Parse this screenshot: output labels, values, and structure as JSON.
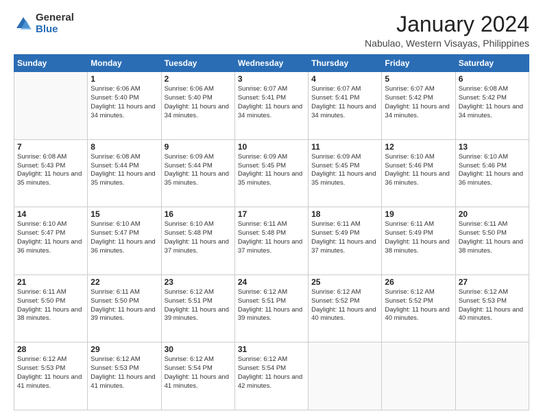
{
  "logo": {
    "general": "General",
    "blue": "Blue"
  },
  "title": "January 2024",
  "location": "Nabulao, Western Visayas, Philippines",
  "days_header": [
    "Sunday",
    "Monday",
    "Tuesday",
    "Wednesday",
    "Thursday",
    "Friday",
    "Saturday"
  ],
  "weeks": [
    [
      {
        "day": "",
        "sunrise": "",
        "sunset": "",
        "daylight": ""
      },
      {
        "day": "1",
        "sunrise": "Sunrise: 6:06 AM",
        "sunset": "Sunset: 5:40 PM",
        "daylight": "Daylight: 11 hours and 34 minutes."
      },
      {
        "day": "2",
        "sunrise": "Sunrise: 6:06 AM",
        "sunset": "Sunset: 5:40 PM",
        "daylight": "Daylight: 11 hours and 34 minutes."
      },
      {
        "day": "3",
        "sunrise": "Sunrise: 6:07 AM",
        "sunset": "Sunset: 5:41 PM",
        "daylight": "Daylight: 11 hours and 34 minutes."
      },
      {
        "day": "4",
        "sunrise": "Sunrise: 6:07 AM",
        "sunset": "Sunset: 5:41 PM",
        "daylight": "Daylight: 11 hours and 34 minutes."
      },
      {
        "day": "5",
        "sunrise": "Sunrise: 6:07 AM",
        "sunset": "Sunset: 5:42 PM",
        "daylight": "Daylight: 11 hours and 34 minutes."
      },
      {
        "day": "6",
        "sunrise": "Sunrise: 6:08 AM",
        "sunset": "Sunset: 5:42 PM",
        "daylight": "Daylight: 11 hours and 34 minutes."
      }
    ],
    [
      {
        "day": "7",
        "sunrise": "Sunrise: 6:08 AM",
        "sunset": "Sunset: 5:43 PM",
        "daylight": "Daylight: 11 hours and 35 minutes."
      },
      {
        "day": "8",
        "sunrise": "Sunrise: 6:08 AM",
        "sunset": "Sunset: 5:44 PM",
        "daylight": "Daylight: 11 hours and 35 minutes."
      },
      {
        "day": "9",
        "sunrise": "Sunrise: 6:09 AM",
        "sunset": "Sunset: 5:44 PM",
        "daylight": "Daylight: 11 hours and 35 minutes."
      },
      {
        "day": "10",
        "sunrise": "Sunrise: 6:09 AM",
        "sunset": "Sunset: 5:45 PM",
        "daylight": "Daylight: 11 hours and 35 minutes."
      },
      {
        "day": "11",
        "sunrise": "Sunrise: 6:09 AM",
        "sunset": "Sunset: 5:45 PM",
        "daylight": "Daylight: 11 hours and 35 minutes."
      },
      {
        "day": "12",
        "sunrise": "Sunrise: 6:10 AM",
        "sunset": "Sunset: 5:46 PM",
        "daylight": "Daylight: 11 hours and 36 minutes."
      },
      {
        "day": "13",
        "sunrise": "Sunrise: 6:10 AM",
        "sunset": "Sunset: 5:46 PM",
        "daylight": "Daylight: 11 hours and 36 minutes."
      }
    ],
    [
      {
        "day": "14",
        "sunrise": "Sunrise: 6:10 AM",
        "sunset": "Sunset: 5:47 PM",
        "daylight": "Daylight: 11 hours and 36 minutes."
      },
      {
        "day": "15",
        "sunrise": "Sunrise: 6:10 AM",
        "sunset": "Sunset: 5:47 PM",
        "daylight": "Daylight: 11 hours and 36 minutes."
      },
      {
        "day": "16",
        "sunrise": "Sunrise: 6:10 AM",
        "sunset": "Sunset: 5:48 PM",
        "daylight": "Daylight: 11 hours and 37 minutes."
      },
      {
        "day": "17",
        "sunrise": "Sunrise: 6:11 AM",
        "sunset": "Sunset: 5:48 PM",
        "daylight": "Daylight: 11 hours and 37 minutes."
      },
      {
        "day": "18",
        "sunrise": "Sunrise: 6:11 AM",
        "sunset": "Sunset: 5:49 PM",
        "daylight": "Daylight: 11 hours and 37 minutes."
      },
      {
        "day": "19",
        "sunrise": "Sunrise: 6:11 AM",
        "sunset": "Sunset: 5:49 PM",
        "daylight": "Daylight: 11 hours and 38 minutes."
      },
      {
        "day": "20",
        "sunrise": "Sunrise: 6:11 AM",
        "sunset": "Sunset: 5:50 PM",
        "daylight": "Daylight: 11 hours and 38 minutes."
      }
    ],
    [
      {
        "day": "21",
        "sunrise": "Sunrise: 6:11 AM",
        "sunset": "Sunset: 5:50 PM",
        "daylight": "Daylight: 11 hours and 38 minutes."
      },
      {
        "day": "22",
        "sunrise": "Sunrise: 6:11 AM",
        "sunset": "Sunset: 5:50 PM",
        "daylight": "Daylight: 11 hours and 39 minutes."
      },
      {
        "day": "23",
        "sunrise": "Sunrise: 6:12 AM",
        "sunset": "Sunset: 5:51 PM",
        "daylight": "Daylight: 11 hours and 39 minutes."
      },
      {
        "day": "24",
        "sunrise": "Sunrise: 6:12 AM",
        "sunset": "Sunset: 5:51 PM",
        "daylight": "Daylight: 11 hours and 39 minutes."
      },
      {
        "day": "25",
        "sunrise": "Sunrise: 6:12 AM",
        "sunset": "Sunset: 5:52 PM",
        "daylight": "Daylight: 11 hours and 40 minutes."
      },
      {
        "day": "26",
        "sunrise": "Sunrise: 6:12 AM",
        "sunset": "Sunset: 5:52 PM",
        "daylight": "Daylight: 11 hours and 40 minutes."
      },
      {
        "day": "27",
        "sunrise": "Sunrise: 6:12 AM",
        "sunset": "Sunset: 5:53 PM",
        "daylight": "Daylight: 11 hours and 40 minutes."
      }
    ],
    [
      {
        "day": "28",
        "sunrise": "Sunrise: 6:12 AM",
        "sunset": "Sunset: 5:53 PM",
        "daylight": "Daylight: 11 hours and 41 minutes."
      },
      {
        "day": "29",
        "sunrise": "Sunrise: 6:12 AM",
        "sunset": "Sunset: 5:53 PM",
        "daylight": "Daylight: 11 hours and 41 minutes."
      },
      {
        "day": "30",
        "sunrise": "Sunrise: 6:12 AM",
        "sunset": "Sunset: 5:54 PM",
        "daylight": "Daylight: 11 hours and 41 minutes."
      },
      {
        "day": "31",
        "sunrise": "Sunrise: 6:12 AM",
        "sunset": "Sunset: 5:54 PM",
        "daylight": "Daylight: 11 hours and 42 minutes."
      },
      {
        "day": "",
        "sunrise": "",
        "sunset": "",
        "daylight": ""
      },
      {
        "day": "",
        "sunrise": "",
        "sunset": "",
        "daylight": ""
      },
      {
        "day": "",
        "sunrise": "",
        "sunset": "",
        "daylight": ""
      }
    ]
  ]
}
